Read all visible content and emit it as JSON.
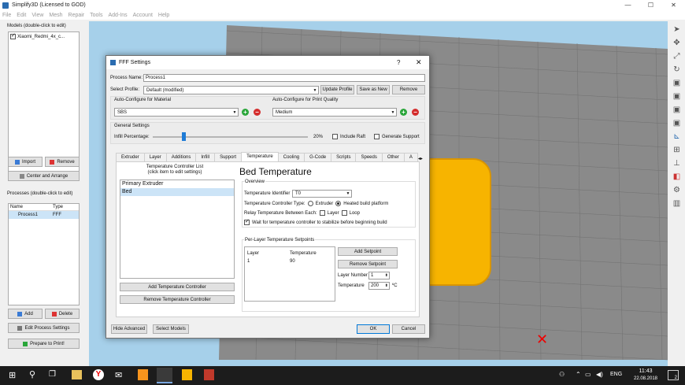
{
  "app": {
    "title": "Simplify3D (Licensed to GOD)",
    "window_buttons": [
      "—",
      "☐",
      "✕"
    ]
  },
  "menu": [
    "File",
    "Edit",
    "View",
    "Mesh",
    "Repair",
    "Tools",
    "Add-Ins",
    "Account",
    "Help"
  ],
  "models": {
    "group": "Models (double-click to edit)",
    "item": "Xiaomi_Redmi_4x_c...",
    "import": "Import",
    "remove": "Remove",
    "center": "Center and Arrange"
  },
  "processes": {
    "group": "Processes (double-click to edit)",
    "col_name": "Name",
    "col_type": "Type",
    "row_name": "Process1",
    "row_type": "FFF",
    "add": "Add",
    "delete": "Delete",
    "edit": "Edit Process Settings",
    "prepare": "Prepare to Print!"
  },
  "dialog": {
    "title": "FFF Settings",
    "help": "?",
    "close": "✕",
    "process_name_label": "Process Name:",
    "process_name": "Process1",
    "profile_label": "Select Profile:",
    "profile": "Default (modified)",
    "update_profile": "Update Profile",
    "save_as_new": "Save as New",
    "remove": "Remove",
    "material_label": "Auto-Configure for Material",
    "material": "SBS",
    "quality_label": "Auto-Configure for Print Quality",
    "quality": "Medium",
    "general_label": "General Settings",
    "infill_label": "Infill Percentage:",
    "infill_value": "20%",
    "infill_fraction": 0.2,
    "include_raft": "Include Raft",
    "generate_support": "Generate Support",
    "tabs": [
      "Extruder",
      "Layer",
      "Additions",
      "Infill",
      "Support",
      "Temperature",
      "Cooling",
      "G-Code",
      "Scripts",
      "Speeds",
      "Other",
      "A"
    ],
    "active_tab": "Temperature",
    "temp_list_title": "Temperature Controller List",
    "temp_list_sub": "(click item to edit settings)",
    "controllers": [
      "Primary Extruder",
      "Bed"
    ],
    "selected_controller": "Bed",
    "add_controller": "Add Temperature Controller",
    "remove_controller": "Remove Temperature Controller",
    "heading": "Bed Temperature",
    "overview": "Overview",
    "identifier_label": "Temperature Identifier",
    "identifier": "T0",
    "ctype_label": "Temperature Controller Type:",
    "extruder": "Extruder",
    "heated": "Heated build platform",
    "relay_label": "Relay Temperature Between Each:",
    "relay_layer": "Layer",
    "relay_loop": "Loop",
    "wait_label": "Wait for temperature controller to stabilize before beginning build",
    "setpoints_label": "Per-Layer Temperature Setpoints",
    "col_layer": "Layer",
    "col_temp": "Temperature",
    "sp_layer": "1",
    "sp_temp": "90",
    "add_setpoint": "Add Setpoint",
    "remove_setpoint": "Remove Setpoint",
    "layer_number_label": "Layer Number",
    "layer_number": "1",
    "temperature_label": "Temperature",
    "temperature": "200",
    "unit": "ºC",
    "hide_advanced": "Hide Advanced",
    "select_models": "Select Models",
    "ok": "OK",
    "cancel": "Cancel"
  },
  "taskbar": {
    "lang": "ENG",
    "time": "11:43",
    "date": "22.08.2018",
    "notif": "2"
  }
}
